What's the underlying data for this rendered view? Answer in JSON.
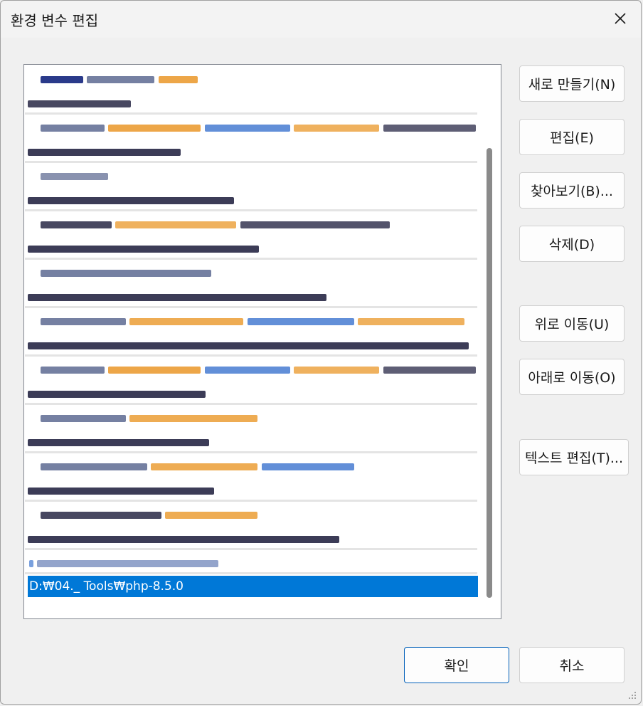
{
  "window": {
    "title": "환경 변수 편집"
  },
  "list": {
    "selected_value": "D:₩04._ Tools₩php-8.5.0",
    "colors": {
      "selection": "#0078d7",
      "orange": "#e8901a",
      "blue": "#2060c8",
      "dark": "#1a1a1a"
    }
  },
  "buttons": {
    "new": "새로 만들기(N)",
    "edit": "편집(E)",
    "browse": "찾아보기(B)...",
    "delete": "삭제(D)",
    "move_up": "위로 이동(U)",
    "move_down": "아래로 이동(O)",
    "edit_text": "텍스트 편집(T)...",
    "ok": "확인",
    "cancel": "취소"
  }
}
